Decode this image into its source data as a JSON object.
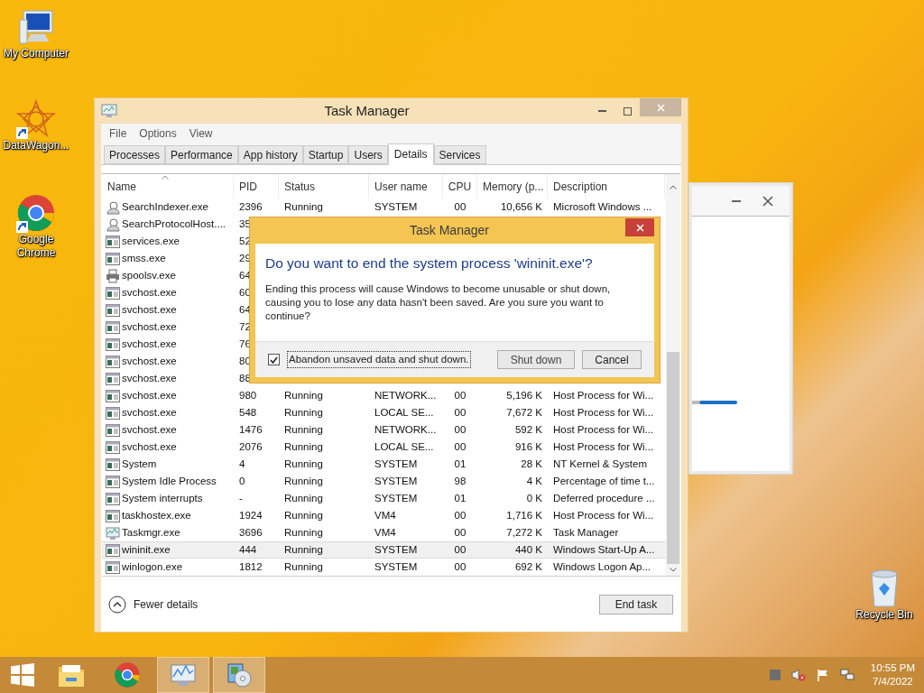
{
  "desktop_icons": [
    {
      "label": "My Computer",
      "kind": "computer",
      "shortcut": false
    },
    {
      "label": "DataWagon...",
      "kind": "star",
      "shortcut": true
    },
    {
      "label": "Google Chrome",
      "kind": "chrome",
      "shortcut": true
    },
    {
      "label": "Recycle Bin",
      "kind": "bin",
      "shortcut": false
    }
  ],
  "task_manager": {
    "title": "Task Manager",
    "menu": [
      "File",
      "Options",
      "View"
    ],
    "tabs": [
      {
        "label": "Processes",
        "selected": false
      },
      {
        "label": "Performance",
        "selected": false
      },
      {
        "label": "App history",
        "selected": false
      },
      {
        "label": "Startup",
        "selected": false
      },
      {
        "label": "Users",
        "selected": false
      },
      {
        "label": "Details",
        "selected": true
      },
      {
        "label": "Services",
        "selected": false
      }
    ],
    "columns": [
      {
        "label": "Name",
        "sorted": true
      },
      {
        "label": "PID",
        "sorted": false
      },
      {
        "label": "Status",
        "sorted": false
      },
      {
        "label": "User name",
        "sorted": false
      },
      {
        "label": "CPU",
        "sorted": false
      },
      {
        "label": "Memory (p...",
        "sorted": false
      },
      {
        "label": "Description",
        "sorted": false
      }
    ],
    "rows": [
      {
        "kind": "search",
        "selected": false,
        "cells": [
          "SearchIndexer.exe",
          "2396",
          "Running",
          "SYSTEM",
          "00",
          "10,656 K",
          "Microsoft Windows ..."
        ]
      },
      {
        "kind": "search",
        "selected": false,
        "cells": [
          "SearchProtocolHost....",
          "35"
        ]
      },
      {
        "kind": "app",
        "selected": false,
        "cells": [
          "services.exe",
          "52"
        ]
      },
      {
        "kind": "app",
        "selected": false,
        "cells": [
          "smss.exe",
          "29"
        ]
      },
      {
        "kind": "printer",
        "selected": false,
        "cells": [
          "spoolsv.exe",
          "64"
        ]
      },
      {
        "kind": "app",
        "selected": false,
        "cells": [
          "svchost.exe",
          "60"
        ]
      },
      {
        "kind": "app",
        "selected": false,
        "cells": [
          "svchost.exe",
          "64"
        ]
      },
      {
        "kind": "app",
        "selected": false,
        "cells": [
          "svchost.exe",
          "72"
        ]
      },
      {
        "kind": "app",
        "selected": false,
        "cells": [
          "svchost.exe",
          "76"
        ]
      },
      {
        "kind": "app",
        "selected": false,
        "cells": [
          "svchost.exe",
          "80"
        ]
      },
      {
        "kind": "app",
        "selected": false,
        "cells": [
          "svchost.exe",
          "88"
        ]
      },
      {
        "kind": "app",
        "selected": false,
        "cells": [
          "svchost.exe",
          "980",
          "Running",
          "NETWORK...",
          "00",
          "5,196 K",
          "Host Process for Wi..."
        ]
      },
      {
        "kind": "app",
        "selected": false,
        "cells": [
          "svchost.exe",
          "548",
          "Running",
          "LOCAL SE...",
          "00",
          "7,672 K",
          "Host Process for Wi..."
        ]
      },
      {
        "kind": "app",
        "selected": false,
        "cells": [
          "svchost.exe",
          "1476",
          "Running",
          "NETWORK...",
          "00",
          "592 K",
          "Host Process for Wi..."
        ]
      },
      {
        "kind": "app",
        "selected": false,
        "cells": [
          "svchost.exe",
          "2076",
          "Running",
          "LOCAL SE...",
          "00",
          "916 K",
          "Host Process for Wi..."
        ]
      },
      {
        "kind": "app",
        "selected": false,
        "cells": [
          "System",
          "4",
          "Running",
          "SYSTEM",
          "01",
          "28 K",
          "NT Kernel & System"
        ]
      },
      {
        "kind": "app",
        "selected": false,
        "cells": [
          "System Idle Process",
          "0",
          "Running",
          "SYSTEM",
          "98",
          "4 K",
          "Percentage of time t..."
        ]
      },
      {
        "kind": "app",
        "selected": false,
        "cells": [
          "System interrupts",
          "-",
          "Running",
          "SYSTEM",
          "01",
          "0 K",
          "Deferred procedure ..."
        ]
      },
      {
        "kind": "app",
        "selected": false,
        "cells": [
          "taskhostex.exe",
          "1924",
          "Running",
          "VM4",
          "00",
          "1,716 K",
          "Host Process for Wi..."
        ]
      },
      {
        "kind": "taskmgr",
        "selected": false,
        "cells": [
          "Taskmgr.exe",
          "3696",
          "Running",
          "VM4",
          "00",
          "7,272 K",
          "Task Manager"
        ]
      },
      {
        "kind": "app",
        "selected": true,
        "cells": [
          "wininit.exe",
          "444",
          "Running",
          "SYSTEM",
          "00",
          "440 K",
          "Windows Start-Up A..."
        ]
      },
      {
        "kind": "app",
        "selected": false,
        "cells": [
          "winlogon.exe",
          "1812",
          "Running",
          "SYSTEM",
          "00",
          "692 K",
          "Windows Logon Ap..."
        ]
      }
    ],
    "fewer_details": "Fewer details",
    "end_task": "End task"
  },
  "dialog": {
    "title": "Task Manager",
    "question": "Do you want to end the system process 'wininit.exe'?",
    "message": "Ending this process will cause Windows to become unusable or shut down, causing you to lose any data hasn't been saved. Are you sure you want to continue?",
    "checkbox": {
      "label": "Abandon unsaved data and shut down.",
      "checked": true
    },
    "buttons": [
      "Shut down",
      "Cancel"
    ]
  },
  "taskbar": {
    "apps": [
      {
        "kind": "folder",
        "active": false
      },
      {
        "kind": "chrome",
        "active": false
      },
      {
        "kind": "taskmgr",
        "active": true
      },
      {
        "kind": "setup",
        "active": true
      }
    ],
    "time": "10:55 PM",
    "date": "7/4/2022"
  }
}
